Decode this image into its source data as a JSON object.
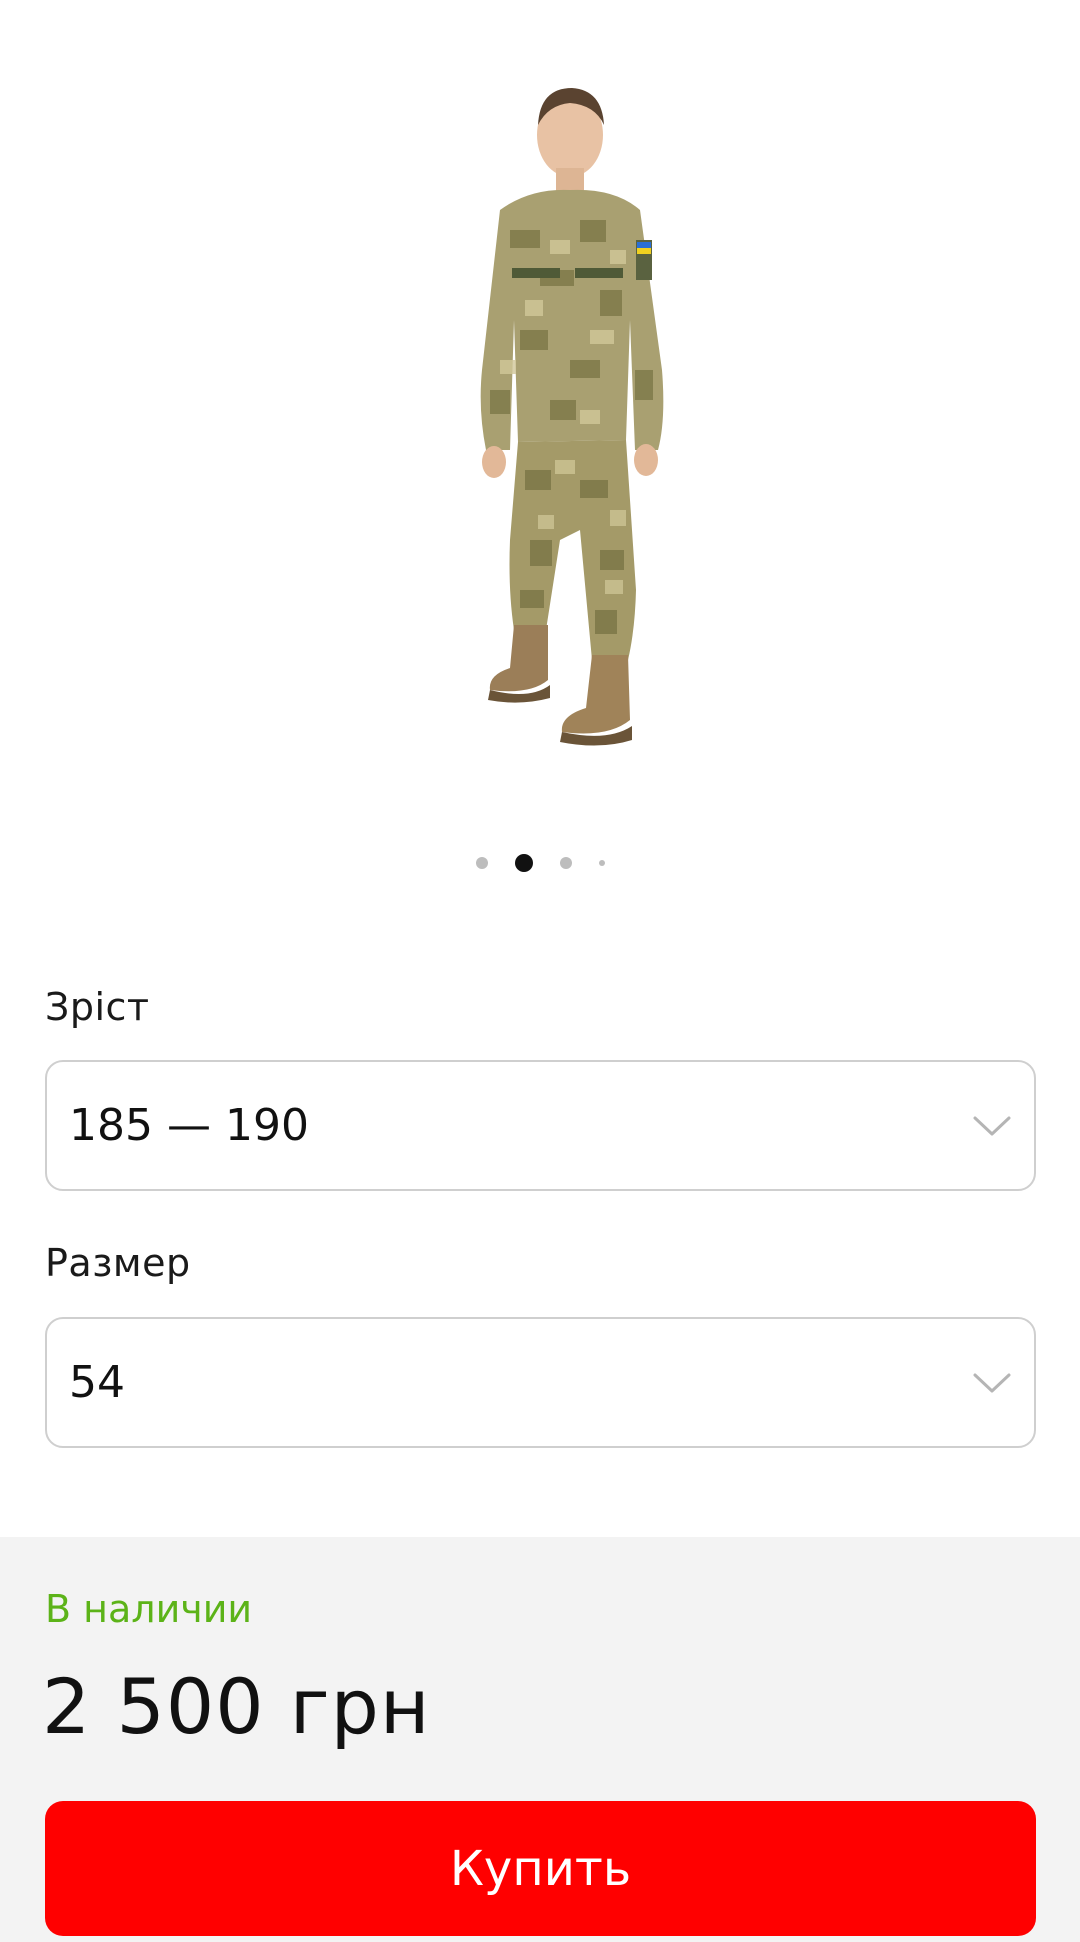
{
  "gallery": {
    "image_alt": "Camouflage uniform product photo",
    "total_slides": 4,
    "active_slide": 2
  },
  "options": {
    "height": {
      "label": "Зріст",
      "selected": "185 — 190"
    },
    "size": {
      "label": "Размер",
      "selected": "54"
    }
  },
  "purchase": {
    "stock_status": "В наличии",
    "price": "2 500 грн",
    "buy_label": "Купить"
  },
  "colors": {
    "stock_green": "#5cb318",
    "buy_red": "#ff0000",
    "panel_bg": "#f3f3f3"
  }
}
